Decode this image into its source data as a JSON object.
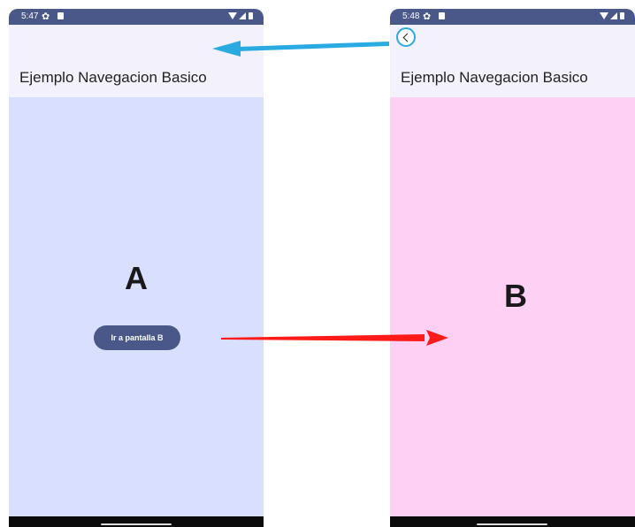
{
  "screens": [
    {
      "time": "5:47",
      "title": "Ejemplo Navegacion Basico",
      "letter": "A",
      "button_label": "Ir a pantalla B",
      "content_color": "#d8dfff"
    },
    {
      "time": "5:48",
      "title": "Ejemplo Navegacion Basico",
      "letter": "B",
      "content_color": "#fed0f4",
      "back_icon": "chevron-left-icon"
    }
  ],
  "colors": {
    "status_bar": "#4a5789",
    "app_bar": "#f3f2fc",
    "button": "#4a5789",
    "back_arrow": "#29aae1",
    "forward_arrow": "#ff0000"
  },
  "icons": [
    "gear-icon",
    "sd-card-icon",
    "wifi-icon",
    "signal-icon",
    "battery-icon",
    "chevron-left-icon",
    "arrow-left-icon",
    "arrow-right-icon"
  ]
}
